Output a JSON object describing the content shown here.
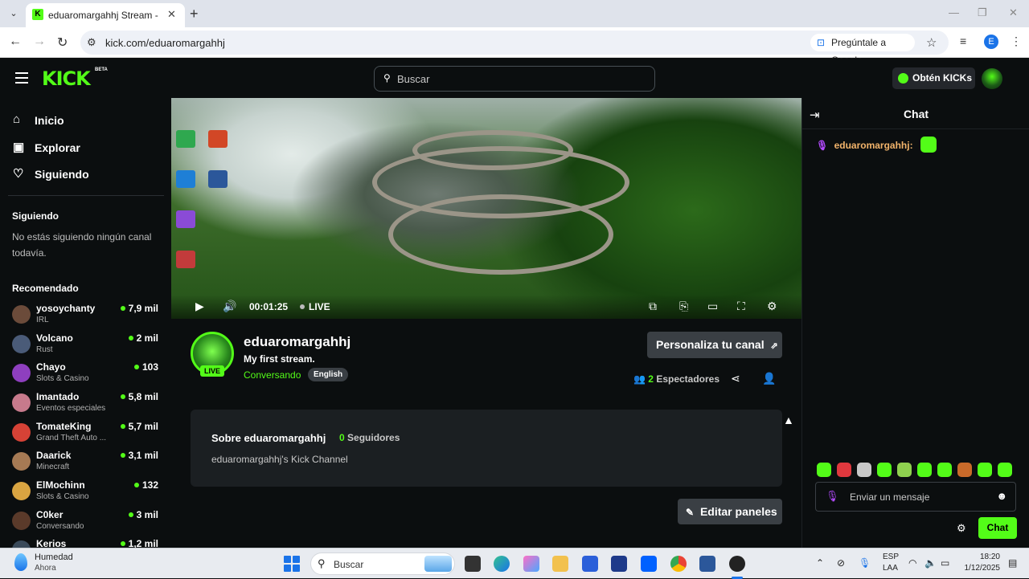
{
  "browser": {
    "tab_title": "eduaromargahhj Stream - Watc",
    "url": "kick.com/eduaromargahhj",
    "google_button": "Pregúntale a Google",
    "profile_initial": "E"
  },
  "header": {
    "logo": "KICK",
    "logo_badge": "BETA",
    "search_placeholder": "Buscar",
    "kicks_button": "Obtén KICKs"
  },
  "sidebar": {
    "nav": [
      {
        "label": "Inicio",
        "icon": "home-icon"
      },
      {
        "label": "Explorar",
        "icon": "explore-icon"
      },
      {
        "label": "Siguiendo",
        "icon": "heart-icon"
      }
    ],
    "following_title": "Siguiendo",
    "following_empty": "No estás siguiendo ningún canal todavía.",
    "recommended_title": "Recomendado",
    "recommended": [
      {
        "name": "yosoychanty",
        "category": "IRL",
        "viewers": "7,9 mil",
        "color": "#6b4b3a"
      },
      {
        "name": "Volcano",
        "category": "Rust",
        "viewers": "2 mil",
        "color": "#4a5b78"
      },
      {
        "name": "Chayo",
        "category": "Slots & Casino",
        "viewers": "103",
        "color": "#8e3fbf"
      },
      {
        "name": "Imantado",
        "category": "Eventos especiales",
        "viewers": "5,8 mil",
        "color": "#c77a8c"
      },
      {
        "name": "TomateKing",
        "category": "Grand Theft Auto ...",
        "viewers": "5,7 mil",
        "color": "#d64236"
      },
      {
        "name": "Daarick",
        "category": "Minecraft",
        "viewers": "3,1 mil",
        "color": "#a67a54"
      },
      {
        "name": "ElMochinn",
        "category": "Slots & Casino",
        "viewers": "132",
        "color": "#d9a441"
      },
      {
        "name": "C0ker",
        "category": "Conversando",
        "viewers": "3 mil",
        "color": "#5a3a2a"
      },
      {
        "name": "Kerios",
        "category": "",
        "viewers": "1,2 mil",
        "color": "#3a4a5a"
      }
    ]
  },
  "player": {
    "time": "00:01:25",
    "live_label": "LIVE"
  },
  "channel": {
    "name": "eduaromargahhj",
    "live_badge": "LIVE",
    "stream_title": "My first stream.",
    "category": "Conversando",
    "language": "English",
    "customize_button": "Personaliza tu canal",
    "viewers_count": "2",
    "viewers_label": "Espectadores",
    "about_title": "Sobre eduaromargahhj",
    "followers_count": "0",
    "followers_label": "Seguidores",
    "about_desc": "eduaromargahhj's Kick Channel",
    "edit_button": "Editar paneles"
  },
  "chat": {
    "title": "Chat",
    "message_user": "eduaromargahhj:",
    "input_placeholder": "Enviar un mensaje",
    "send_button": "Chat",
    "emote_colors": [
      "#53fc18",
      "#e0383e",
      "#c8c8c8",
      "#53fc18",
      "#8fd14f",
      "#53fc18",
      "#53fc18",
      "#c96a2a",
      "#53fc18",
      "#53fc18"
    ]
  },
  "taskbar": {
    "weather_title": "Humedad",
    "weather_sub": "Ahora",
    "search_placeholder": "Buscar",
    "lang_top": "ESP",
    "lang_bottom": "LAA",
    "time": "18:20",
    "date": "1/12/2025"
  },
  "colors": {
    "accent": "#53fc18",
    "background": "#0b0e0f",
    "panel": "#1b1f22"
  }
}
